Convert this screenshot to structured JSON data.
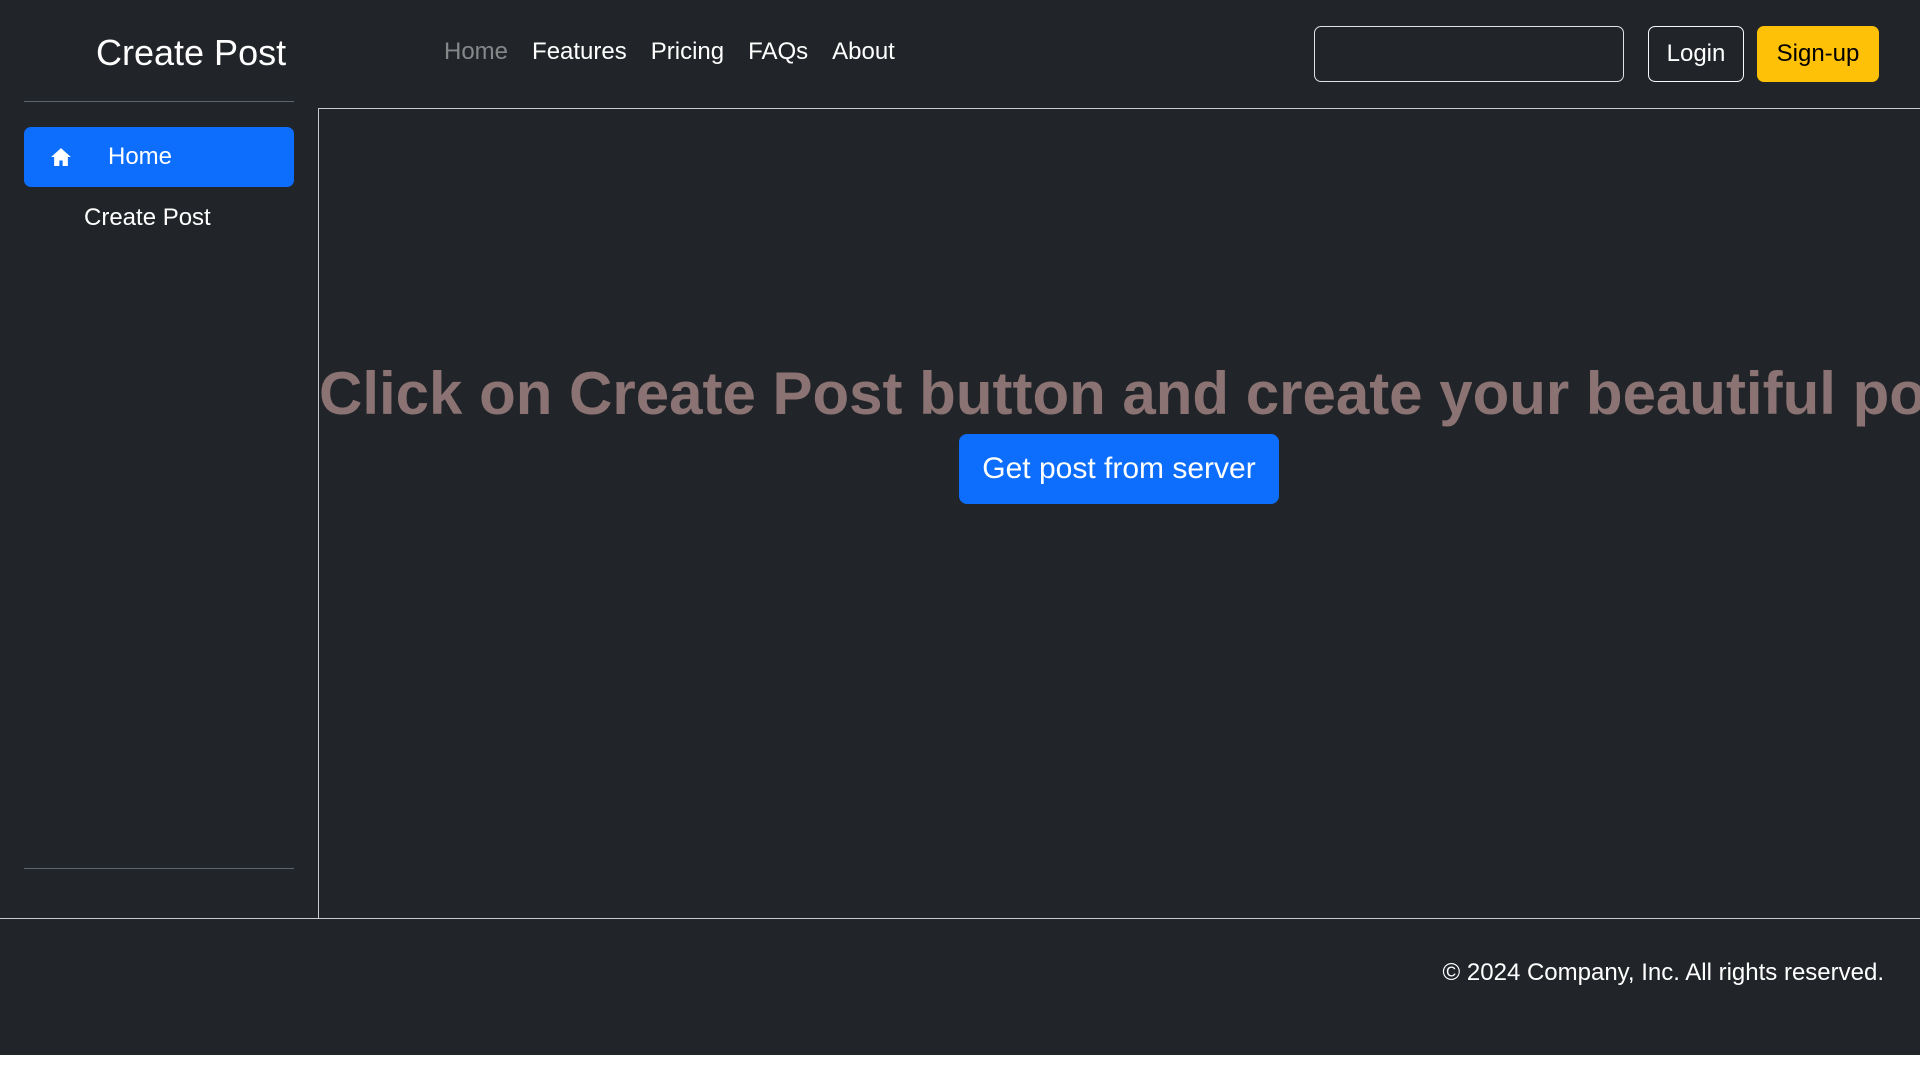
{
  "sidebar": {
    "brand": "Create Post",
    "items": [
      {
        "label": "Home",
        "icon": "home-icon",
        "active": true
      },
      {
        "label": "Create Post",
        "active": false
      }
    ]
  },
  "header": {
    "nav": [
      {
        "label": "Home",
        "muted": true
      },
      {
        "label": "Features"
      },
      {
        "label": "Pricing"
      },
      {
        "label": "FAQs"
      },
      {
        "label": "About"
      }
    ],
    "search": {
      "value": "",
      "placeholder": ""
    },
    "login_label": "Login",
    "signup_label": "Sign-up"
  },
  "main": {
    "headline": "Click on Create Post button and create your beautiful post",
    "get_post_label": "Get post from server"
  },
  "footer": {
    "copyright": "© 2024 Company, Inc. All rights reserved."
  },
  "colors": {
    "background": "#212529",
    "primary": "#0d6efd",
    "warning": "#ffc107",
    "headline": "#8c7373"
  }
}
